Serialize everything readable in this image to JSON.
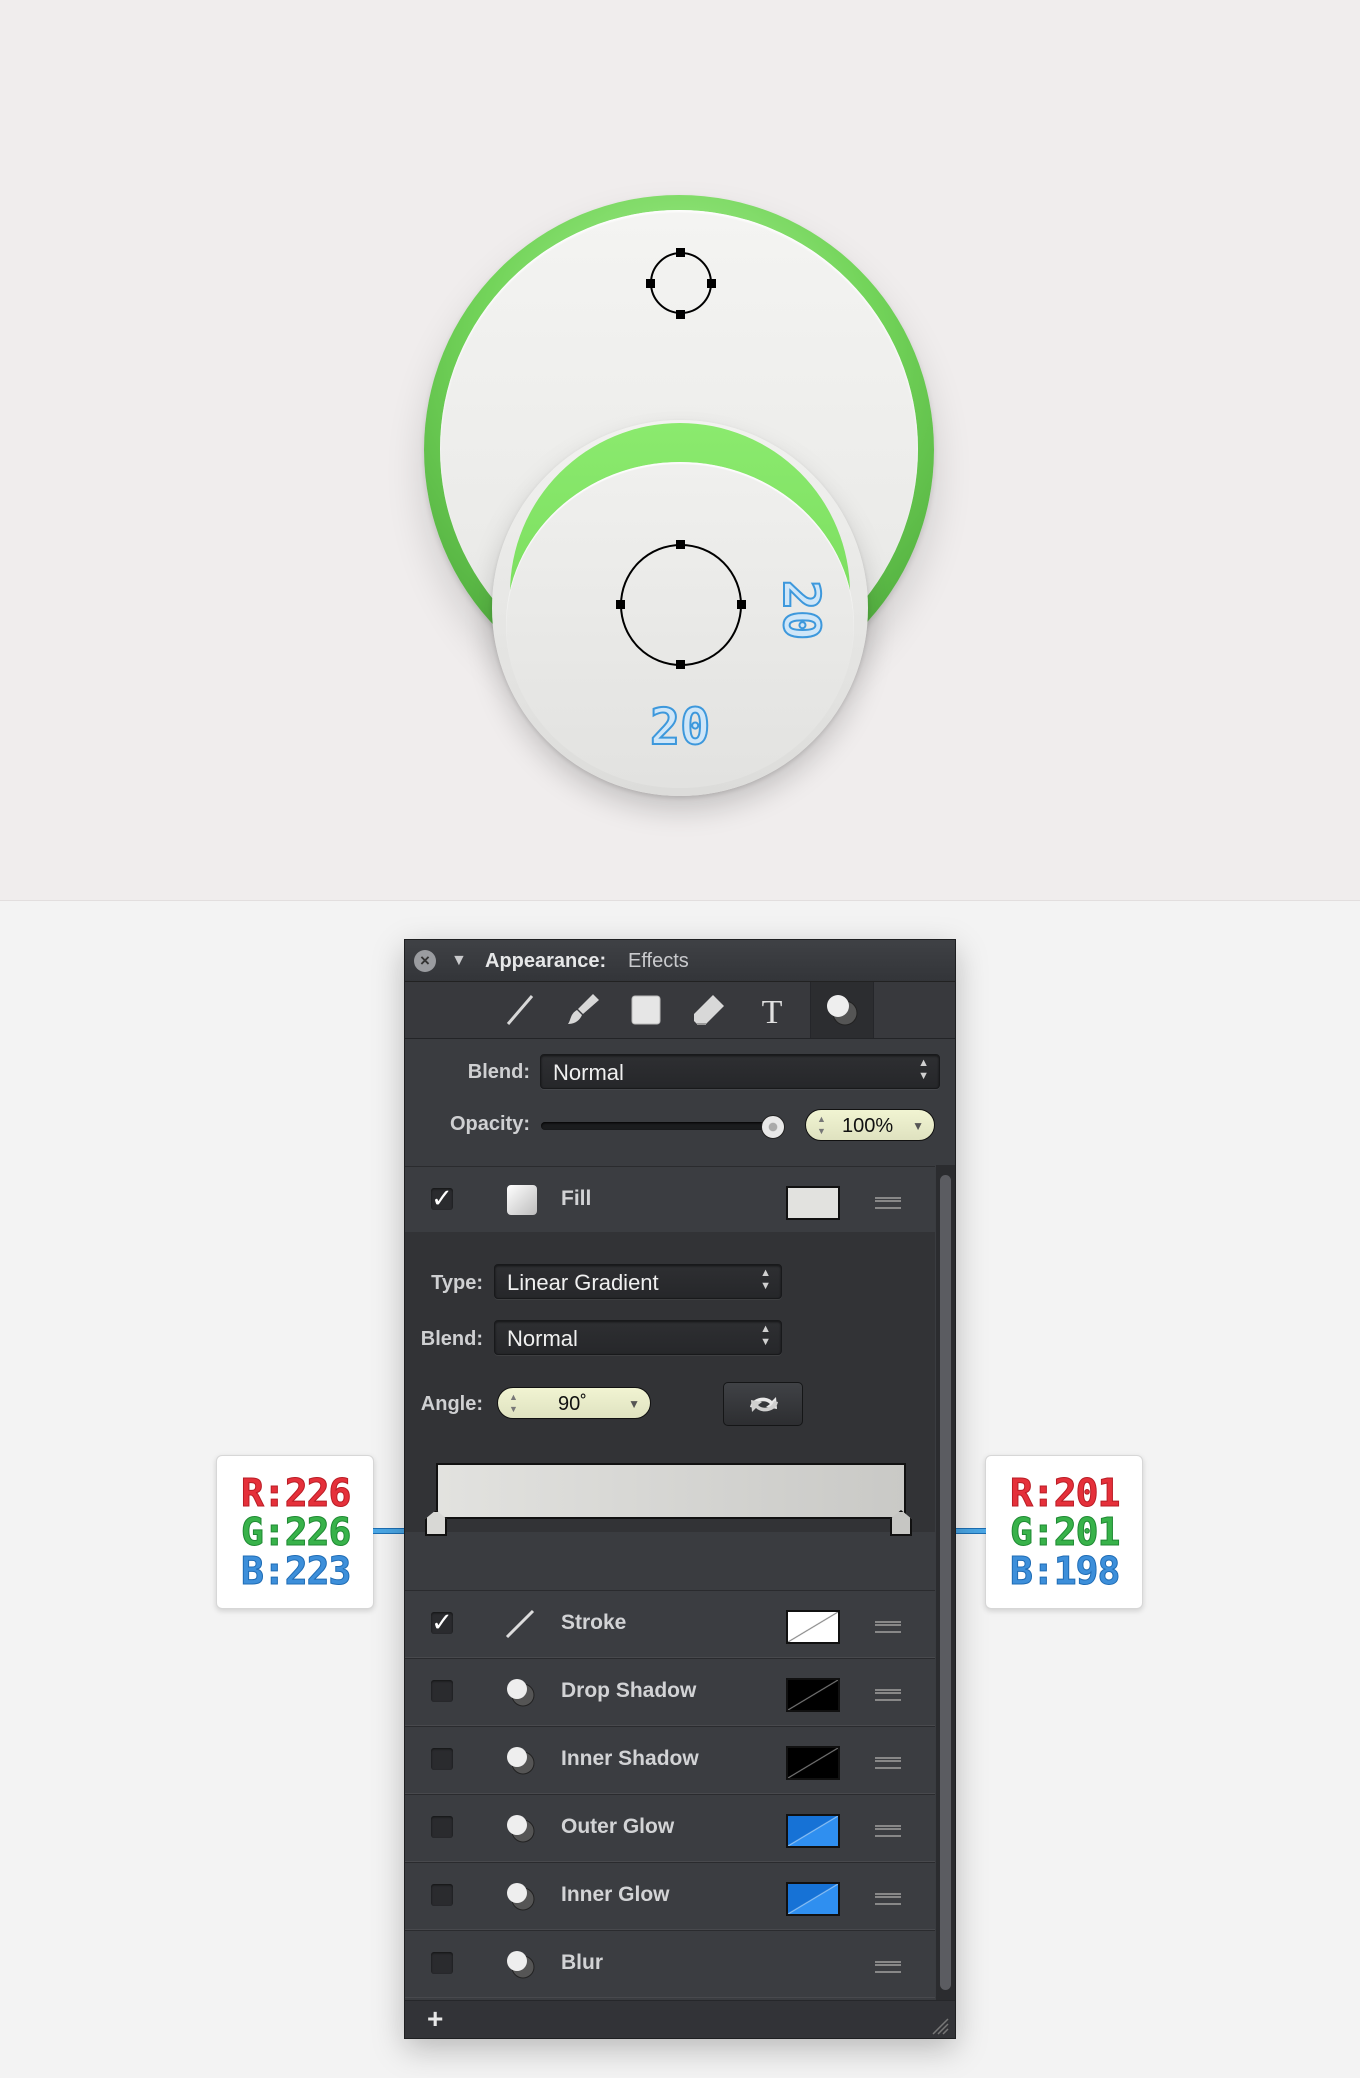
{
  "illustration": {
    "measure_vertical": "20",
    "measure_horizontal": "20"
  },
  "panel": {
    "title": "Appearance:",
    "subtitle": "Effects",
    "toolbar_icons": [
      "line-icon",
      "brush-icon",
      "square-icon",
      "eraser-icon",
      "text-icon",
      "effects-icon"
    ],
    "blend_label": "Blend:",
    "blend_value": "Normal",
    "opacity_label": "Opacity:",
    "opacity_value": "100%",
    "opacity_level": 1.0
  },
  "fill": {
    "label": "Fill",
    "checked": true,
    "swatch_color": "#e2e2df",
    "type_label": "Type:",
    "type_value": "Linear Gradient",
    "blend_label": "Blend:",
    "blend_value": "Normal",
    "angle_label": "Angle:",
    "angle_value": "90˚",
    "gradient_start": "#e2e2df",
    "gradient_end": "#c9c9c6"
  },
  "effects": [
    {
      "label": "Stroke",
      "checked": true,
      "swatch": "stroke-none"
    },
    {
      "label": "Drop Shadow",
      "checked": false,
      "swatch": "black"
    },
    {
      "label": "Inner Shadow",
      "checked": false,
      "swatch": "black"
    },
    {
      "label": "Outer Glow",
      "checked": false,
      "swatch": "blue"
    },
    {
      "label": "Inner Glow",
      "checked": false,
      "swatch": "blue"
    },
    {
      "label": "Blur",
      "checked": false,
      "swatch": ""
    }
  ],
  "footer": {
    "add_label": "+"
  },
  "callouts": {
    "left": {
      "r": "R:226",
      "g": "G:226",
      "b": "B:223"
    },
    "right": {
      "r": "R:201",
      "g": "G:201",
      "b": "B:198"
    }
  },
  "colors": {
    "accent_green": "#73d45a",
    "measure_blue": "#3d98dc",
    "panel_bg": "#3a3c40"
  }
}
